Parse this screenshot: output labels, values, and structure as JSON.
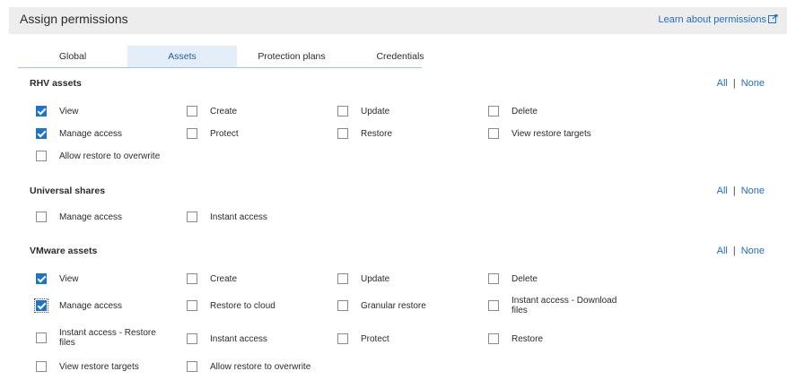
{
  "header": {
    "title": "Assign permissions",
    "learn_link": "Learn about permissions",
    "link_icon": "external-link-icon"
  },
  "tabs": [
    {
      "label": "Global",
      "active": false
    },
    {
      "label": "Assets",
      "active": true
    },
    {
      "label": "Protection plans",
      "active": false
    },
    {
      "label": "Credentials",
      "active": false
    }
  ],
  "all_label": "All",
  "none_label": "None",
  "accent_color": "#1f73c9",
  "sections": {
    "rhv": {
      "title": "RHV assets",
      "items": [
        {
          "label": "View",
          "checked": true
        },
        {
          "label": "Create",
          "checked": false
        },
        {
          "label": "Update",
          "checked": false
        },
        {
          "label": "Delete",
          "checked": false
        },
        {
          "label": "Manage access",
          "checked": true
        },
        {
          "label": "Protect",
          "checked": false
        },
        {
          "label": "Restore",
          "checked": false
        },
        {
          "label": "View restore targets",
          "checked": false
        },
        {
          "label": "Allow restore to overwrite",
          "checked": false
        }
      ]
    },
    "universal": {
      "title": "Universal shares",
      "items": [
        {
          "label": "Manage access",
          "checked": false
        },
        {
          "label": "Instant access",
          "checked": false
        }
      ]
    },
    "vmware": {
      "title": "VMware assets",
      "items": [
        {
          "label": "View",
          "checked": true
        },
        {
          "label": "Create",
          "checked": false
        },
        {
          "label": "Update",
          "checked": false
        },
        {
          "label": "Delete",
          "checked": false
        },
        {
          "label": "Manage access",
          "checked": true
        },
        {
          "label": "Restore to cloud",
          "checked": false
        },
        {
          "label": "Granular restore",
          "checked": false
        },
        {
          "label": "Instant access - Download files",
          "checked": false
        },
        {
          "label": "Instant access - Restore files",
          "checked": false
        },
        {
          "label": "Instant access",
          "checked": false
        },
        {
          "label": "Protect",
          "checked": false
        },
        {
          "label": "Restore",
          "checked": false
        },
        {
          "label": "View restore targets",
          "checked": false
        },
        {
          "label": "Allow restore to overwrite",
          "checked": false
        }
      ]
    }
  }
}
